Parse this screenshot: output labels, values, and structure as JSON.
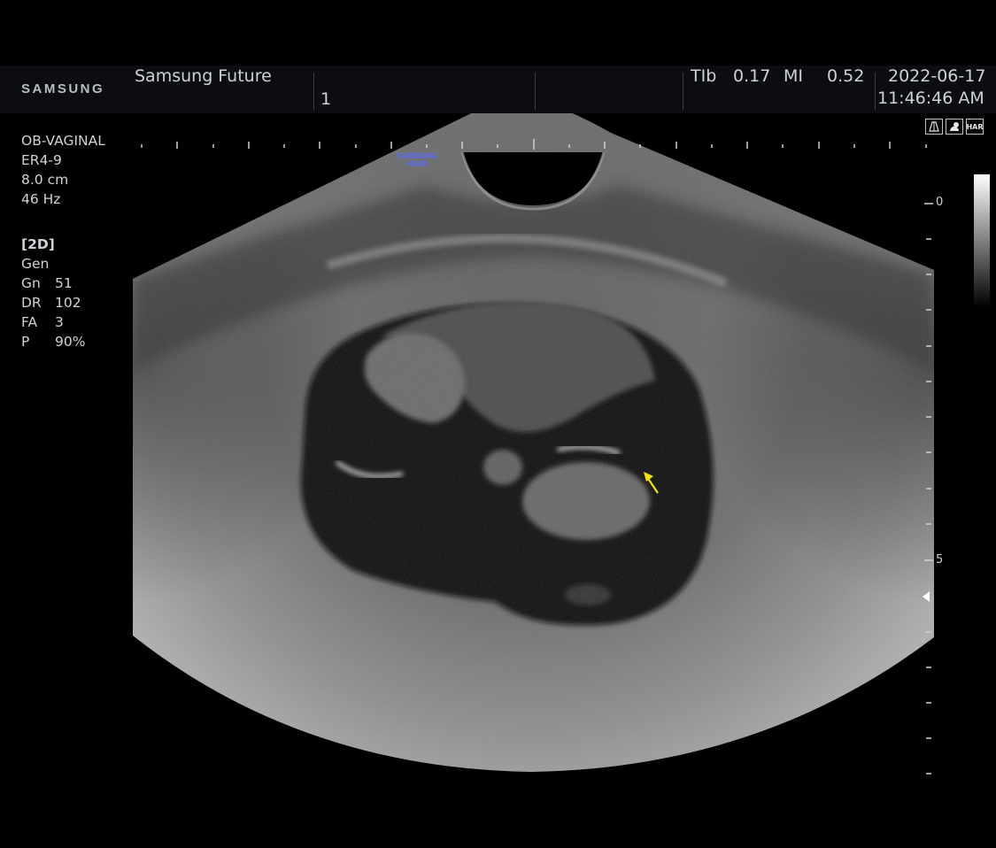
{
  "header": {
    "brand": "SAMSUNG",
    "institution": "Samsung Future",
    "patient_field": "1",
    "tib_label": "TIb",
    "tib_value": "0.17",
    "mi_label": "MI",
    "mi_value": "0.52",
    "date": "2022-06-17",
    "time": "11:46:46 AM"
  },
  "probe_info": {
    "preset": "OB-VAGINAL",
    "probe": "ER4-9",
    "depth": "8.0 cm",
    "frame_rate": "46 Hz"
  },
  "imaging_params": {
    "mode": "[2D]",
    "profile": "Gen",
    "gain_label": "Gn",
    "gain_value": "51",
    "dr_label": "DR",
    "dr_value": "102",
    "fa_label": "FA",
    "fa_value": "3",
    "power_label": "P",
    "power_value": "90%"
  },
  "probe_tag": {
    "line1": "SAMSUNG",
    "line2": "HS40"
  },
  "mode_icons": [
    {
      "name": "needle-guide-icon",
      "label": ""
    },
    {
      "name": "fetus-icon",
      "label": ""
    },
    {
      "name": "har-icon",
      "label": "HAR"
    }
  ],
  "depth_scale": {
    "top_label": "0",
    "mid_label": "5"
  },
  "colors": {
    "background": "#000000",
    "header_bg": "#0b0d10",
    "text": "#cfd2d6",
    "probe_tag": "#5a6cff",
    "annotation_arrow": "#f2e600"
  }
}
